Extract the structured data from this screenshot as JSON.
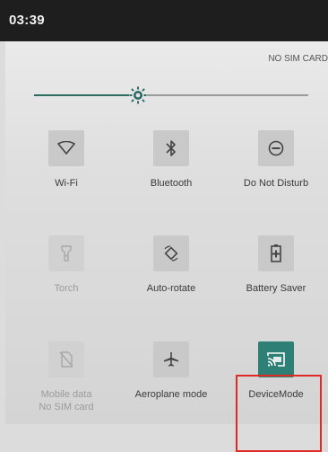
{
  "status_bar": {
    "time": "03:39"
  },
  "panel": {
    "sim_status": "NO SIM CARD"
  },
  "brightness": {
    "level": 0.38,
    "accent_color": "#2a6b64",
    "icon": "sun-icon"
  },
  "tiles": [
    {
      "label": "Wi-Fi",
      "icon": "wifi-icon",
      "state": "inactive"
    },
    {
      "label": "Bluetooth",
      "icon": "bluetooth-icon",
      "state": "inactive"
    },
    {
      "label": "Do Not Disturb",
      "icon": "do-not-disturb-icon",
      "state": "inactive"
    },
    {
      "label": "Torch",
      "icon": "torch-icon",
      "state": "unavailable"
    },
    {
      "label": "Auto-rotate",
      "icon": "auto-rotate-icon",
      "state": "inactive"
    },
    {
      "label": "Battery Saver",
      "icon": "battery-saver-icon",
      "state": "inactive"
    },
    {
      "label": "Mobile data",
      "sublabel": "No SIM card",
      "icon": "mobile-data-off-icon",
      "state": "unavailable"
    },
    {
      "label": "Aeroplane mode",
      "icon": "airplane-icon",
      "state": "inactive"
    },
    {
      "label": "DeviceMode",
      "icon": "cast-icon",
      "state": "active"
    }
  ],
  "colors": {
    "active_tile": "#2e7f75",
    "highlight": "#e02a22"
  }
}
